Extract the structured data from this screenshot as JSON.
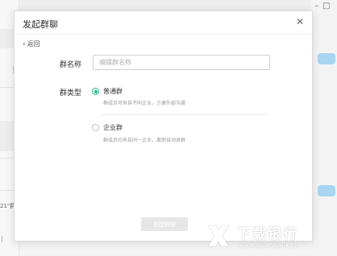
{
  "background": {
    "left_snippet": "21\"群",
    "left_tick": "|"
  },
  "modal": {
    "title": "发起群聊",
    "close_icon": "close-icon",
    "back_label": "返回",
    "group_name": {
      "label": "群名称",
      "placeholder": "编辑群名称",
      "value": ""
    },
    "group_type": {
      "label": "群类型",
      "options": [
        {
          "label": "普通群",
          "description": "群成员可来自不同企业，方便外部沟通",
          "selected": true
        },
        {
          "label": "企业群",
          "description": "群成员均来自同一企业，离职自动退群",
          "selected": false
        }
      ]
    },
    "create_button": "创建群聊"
  },
  "watermark": {
    "title": "下载银行",
    "url": "www.downbank.cn"
  },
  "colors": {
    "accent": "#1fb98a",
    "button_disabled": "#e6e6e6",
    "bubble": "#a9d6f2"
  }
}
